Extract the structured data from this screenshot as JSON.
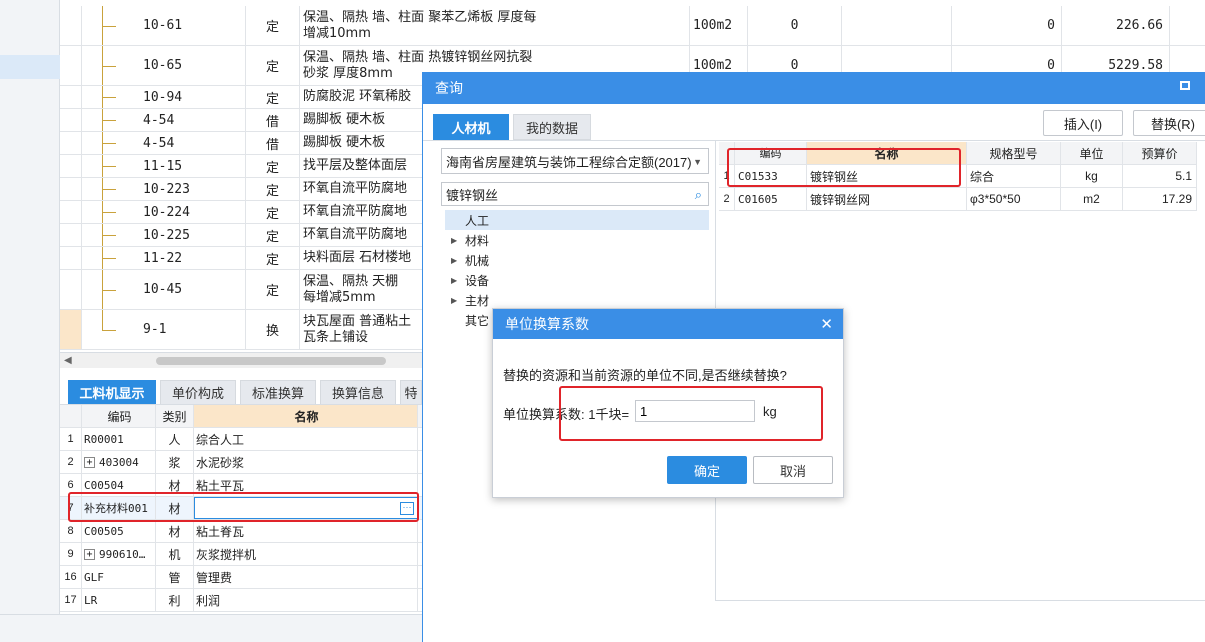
{
  "upper_table": {
    "rows": [
      {
        "code": "10-61",
        "type": "定",
        "name_line1": "保温、隔热 墙、柱面 聚苯乙烯板 厚度每",
        "name_line2": "增减10mm",
        "unit": "100m2",
        "qty": "0",
        "total": "0",
        "price": "226.66"
      },
      {
        "code": "10-65",
        "type": "定",
        "name_line1": "保温、隔热 墙、柱面 热镀锌钢丝网抗裂",
        "name_line2": "砂浆 厚度8mm",
        "unit": "100m2",
        "qty": "0",
        "total": "0",
        "price": "5229.58"
      },
      {
        "code": "10-94",
        "type": "定",
        "name_line1": "防腐胶泥 环氧稀胶"
      },
      {
        "code": "4-54",
        "type": "借",
        "name_line1": "踢脚板 硬木板"
      },
      {
        "code": "4-54",
        "type": "借",
        "name_line1": "踢脚板 硬木板"
      },
      {
        "code": "11-15",
        "type": "定",
        "name_line1": "找平层及整体面层"
      },
      {
        "code": "10-223",
        "type": "定",
        "name_line1": "环氧自流平防腐地"
      },
      {
        "code": "10-224",
        "type": "定",
        "name_line1": "环氧自流平防腐地"
      },
      {
        "code": "10-225",
        "type": "定",
        "name_line1": "环氧自流平防腐地"
      },
      {
        "code": "11-22",
        "type": "定",
        "name_line1": "块料面层 石材楼地"
      },
      {
        "code": "10-45",
        "type": "定",
        "name_line1": "保温、隔热 天棚",
        "name_line2": "每增减5mm"
      },
      {
        "code": "9-1",
        "type": "换",
        "name_line1": "块瓦屋面 普通粘土",
        "name_line2": "瓦条上铺设"
      }
    ]
  },
  "lower_tabs": [
    {
      "label": "工料机显示"
    },
    {
      "label": "单价构成"
    },
    {
      "label": "标准换算"
    },
    {
      "label": "换算信息"
    },
    {
      "label": "特"
    }
  ],
  "lower_table": {
    "headers": {
      "code": "编码",
      "type": "类别",
      "name": "名称"
    },
    "rows": [
      {
        "num": "1",
        "code": "R00001",
        "type": "人",
        "name": "综合人工"
      },
      {
        "num": "2",
        "code": "403004",
        "type": "浆",
        "name": "水泥砂浆"
      },
      {
        "num": "6",
        "code": "C00504",
        "type": "材",
        "name": "粘土平瓦"
      },
      {
        "num": "7",
        "code": "补充材料001",
        "type": "材",
        "name": ""
      },
      {
        "num": "8",
        "code": "C00505",
        "type": "材",
        "name": "粘土脊瓦"
      },
      {
        "num": "9",
        "code": "990610…",
        "type": "机",
        "name": "灰浆搅拌机"
      },
      {
        "num": "16",
        "code": "GLF",
        "type": "管",
        "name": "管理费"
      },
      {
        "num": "17",
        "code": "LR",
        "type": "利",
        "name": "利润"
      }
    ]
  },
  "query": {
    "title": "查询",
    "tab_labor": "人材机",
    "tab_mydata": "我的数据",
    "insert_button": "插入(I)",
    "replace_button": "替换(R)",
    "standard": "海南省房屋建筑与装饰工程综合定额(2017)",
    "search_value": "镀锌钢丝",
    "tree": [
      {
        "label": "人工"
      },
      {
        "label": "材料"
      },
      {
        "label": "机械"
      },
      {
        "label": "设备"
      },
      {
        "label": "主材"
      },
      {
        "label": "其它"
      }
    ],
    "results": {
      "headers": {
        "code": "编码",
        "name": "名称",
        "spec": "规格型号",
        "unit": "单位",
        "price": "预算价"
      },
      "rows": [
        {
          "num": "1",
          "code": "C01533",
          "name": "镀锌钢丝",
          "spec": "综合",
          "unit": "kg",
          "price": "5.1"
        },
        {
          "num": "2",
          "code": "C01605",
          "name": "镀锌钢丝网",
          "spec": "φ3*50*50",
          "unit": "m2",
          "price": "17.29"
        }
      ]
    }
  },
  "dialog": {
    "title": "单位换算系数",
    "message": "替换的资源和当前资源的单位不同,是否继续替换?",
    "label": "单位换算系数: 1千块=",
    "value": "1",
    "unit": "kg",
    "ok": "确定",
    "cancel": "取消"
  },
  "colors": {
    "accent": "#3a8ee6",
    "highlight": "#e0242a"
  }
}
